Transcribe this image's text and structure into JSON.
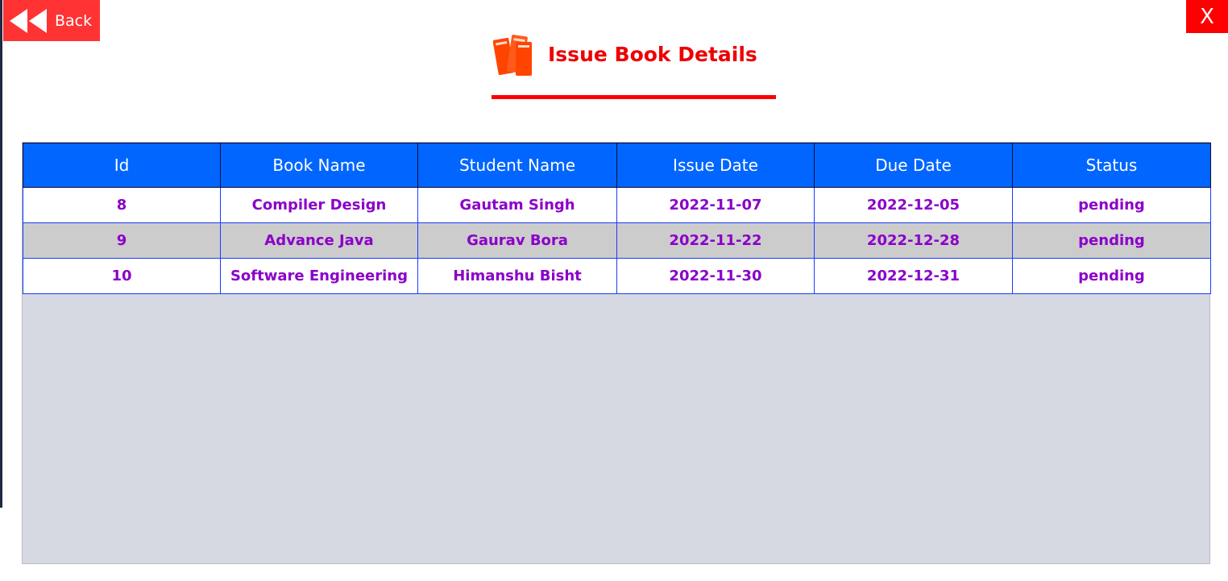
{
  "window": {
    "back_label": "Back",
    "close_label": "X"
  },
  "header": {
    "title": "Issue Book Details",
    "icon": "books-icon",
    "accent_color": "#ff0000"
  },
  "table": {
    "columns": [
      "Id",
      "Book Name",
      "Student Name",
      "Issue Date",
      "Due Date",
      "Status"
    ],
    "rows": [
      {
        "id": "8",
        "book_name": "Compiler Design",
        "student_name": "Gautam Singh",
        "issue_date": "2022-11-07",
        "due_date": "2022-12-05",
        "status": "pending"
      },
      {
        "id": "9",
        "book_name": "Advance Java",
        "student_name": "Gaurav Bora",
        "issue_date": "2022-11-22",
        "due_date": "2022-12-28",
        "status": "pending"
      },
      {
        "id": "10",
        "book_name": "Software Engineering",
        "student_name": "Himanshu Bisht",
        "issue_date": "2022-11-30",
        "due_date": "2022-12-31",
        "status": "pending"
      }
    ],
    "header_color": "#0066ff",
    "text_color": "#8b00c9"
  }
}
